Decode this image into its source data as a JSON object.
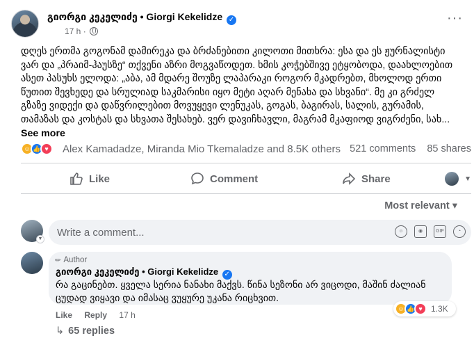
{
  "post": {
    "author": "გიორგი კეკელიძე • Giorgi Kekelidze",
    "time": "17 h",
    "text": "დღეს ერთმა გოგონამ დამირეკა და ბრძანებითი კილოთი მითხრა: ესა და ეს ჟურნალისტი ვარ და „პრაიმ-ჰაუსზე“ თქვენი აზრი მოგვაწოდეთ. ხმის კოჭებშივე ეტყობოდა, დაახლოებით ასეთ პასუხს ელოდა: „აბა, ამ მდარე შოუზე ლაპარაკი როგორ მკადრებთ, მხოლოდ ერთი წუთით შევხედე და სრულიად საკმარისი იყო მეტი აღარ მენახა და სხვანი“. მე კი გრძელ გზაზე ვიდექი და დაწვრილებით მოვუყევი ლენუკას, გოგას, ბაგირას, სალის, გურამის, თამაზას და კოსტას და სხვათა შესახებ. ვერ დავიჩხავლი, მაგრამ მკაფიოდ ვიგრძენი, სახ...",
    "see_more": "See more",
    "reactors": "Alex Kamadadze, Miranda Mio Tkemaladze and 8.5K others",
    "comments_count": "521 comments",
    "shares_count": "85 shares"
  },
  "actions": {
    "like": "Like",
    "comment": "Comment",
    "share": "Share"
  },
  "sort": {
    "label": "Most relevant",
    "caret": "▾"
  },
  "composer": {
    "placeholder": "Write a comment..."
  },
  "reply": {
    "badge": "Author",
    "name": "გიორგი კეკელიძე • Giorgi Kekelidze",
    "text": "რა გაცინებთ. ყველა სერია ნანახი მაქვს. წინა სეზონი არ ვიცოდი, მაშინ ძალიან ცუდად ვიყავი და იმასაც ვუყურე უკანა რიცხვით.",
    "like": "Like",
    "reply": "Reply",
    "time": "17 h",
    "reactions_count": "1.3K",
    "view_replies": "65 replies"
  },
  "colors": {
    "accent": "#1877f2",
    "muted": "#65676b",
    "bubble": "#f0f2f5"
  },
  "icons": [
    "globe-icon",
    "more-icon",
    "like-icon",
    "comment-icon",
    "share-icon",
    "verified-icon"
  ]
}
